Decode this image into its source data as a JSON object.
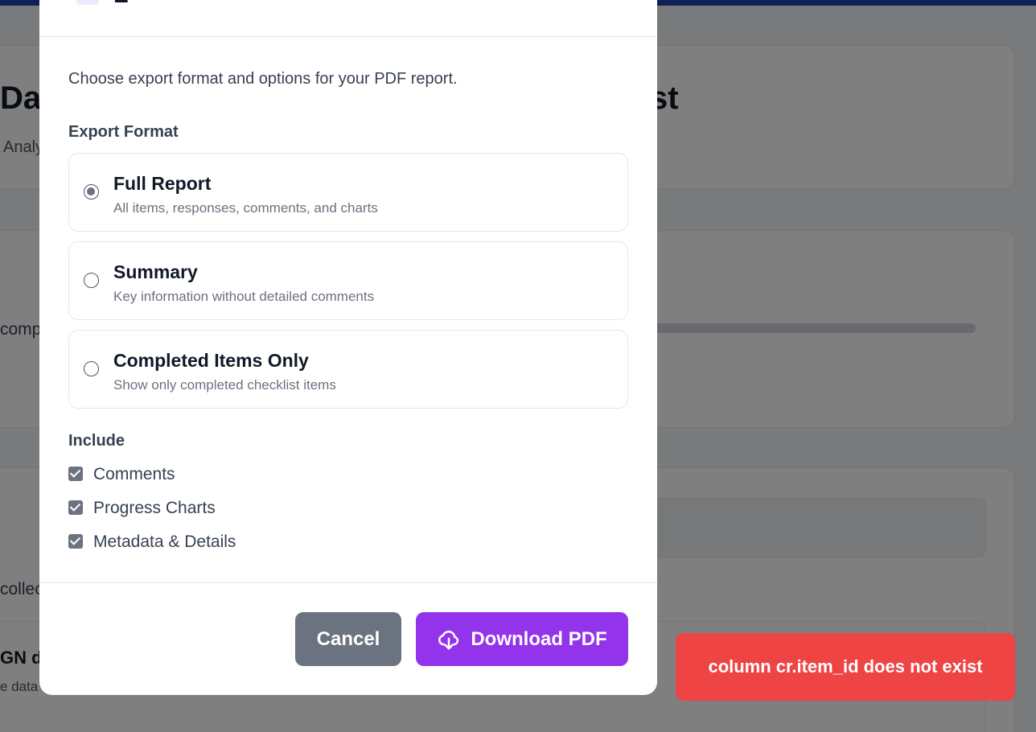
{
  "background": {
    "title_start": "Da",
    "title_end": "st",
    "subtitle": "Analy",
    "label_comp": "comp",
    "label_collect": "collec",
    "row_title": "GN d",
    "row_sub": "e data"
  },
  "modal": {
    "title": "E",
    "close_label": "×",
    "description": "Choose export format and options for your PDF report.",
    "format_label": "Export Format",
    "options": [
      {
        "title": "Full Report",
        "description": "All items, responses, comments, and charts",
        "selected": true
      },
      {
        "title": "Summary",
        "description": "Key information without detailed comments",
        "selected": false
      },
      {
        "title": "Completed Items Only",
        "description": "Show only completed checklist items",
        "selected": false
      }
    ],
    "include_label": "Include",
    "include_items": [
      {
        "label": "Comments",
        "checked": true
      },
      {
        "label": "Progress Charts",
        "checked": true
      },
      {
        "label": "Metadata & Details",
        "checked": true
      }
    ],
    "cancel_label": "Cancel",
    "download_label": "Download PDF",
    "download_icon": "cloud-download-icon"
  },
  "toast": {
    "message": "column cr.item_id does not exist"
  },
  "colors": {
    "primary": "#9333ea",
    "secondary": "#6b7280",
    "error": "#ef4444",
    "topbar": "#1e40af"
  }
}
